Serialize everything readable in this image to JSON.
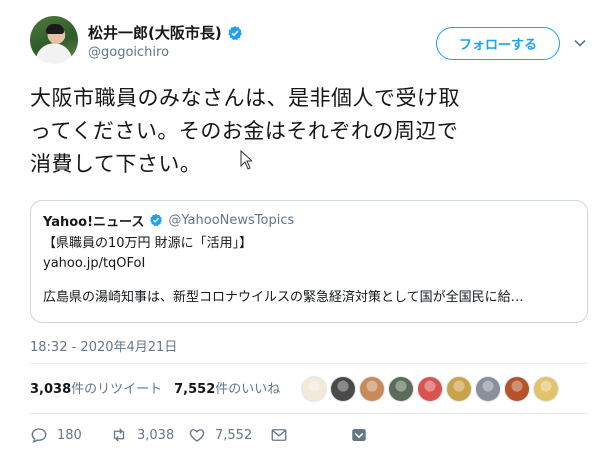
{
  "author": {
    "display_name": "松井一郎(大阪市長)",
    "handle": "@gogoichiro",
    "verified": true
  },
  "follow_button": {
    "label": "フォローする"
  },
  "tweet": {
    "lines": [
      "大阪市職員のみなさんは、是非個人で受け取",
      "ってください。そのお金はそれぞれの周辺で",
      "消費して下さい。"
    ]
  },
  "quote": {
    "name": "Yahoo!ニュース",
    "handle": "@YahooNewsTopics",
    "verified": true,
    "line1": "【県職員の10万円 財源に「活用」】",
    "line2": "yahoo.jp/tqOFoI",
    "line3": "広島県の湯崎知事は、新型コロナウイルスの緊急経済対策として国が全国民に給…"
  },
  "timestamp": "18:32 - 2020年4月21日",
  "stats": {
    "retweets_count": "3,038",
    "retweets_label": "件のリツイート",
    "likes_count": "7,552",
    "likes_label": "件のいいね"
  },
  "likers": {
    "icons": [
      "liker-avatar-1",
      "liker-avatar-2",
      "liker-avatar-3",
      "liker-avatar-4",
      "liker-avatar-5",
      "liker-avatar-6",
      "liker-avatar-7",
      "liker-avatar-8",
      "liker-avatar-9"
    ],
    "colors": [
      "#f3e9d8",
      "#4a4a4a",
      "#c98a5a",
      "#5e6b5a",
      "#d9534f",
      "#c9a24a",
      "#8a8f99",
      "#b5532b",
      "#e2c36b"
    ]
  },
  "actions": {
    "reply_count": "180",
    "retweet_count": "3,038",
    "like_count": "7,552"
  },
  "colors": {
    "accent": "#1da1f2",
    "text": "#14171a",
    "muted": "#657786",
    "border": "#ccd6dd"
  }
}
